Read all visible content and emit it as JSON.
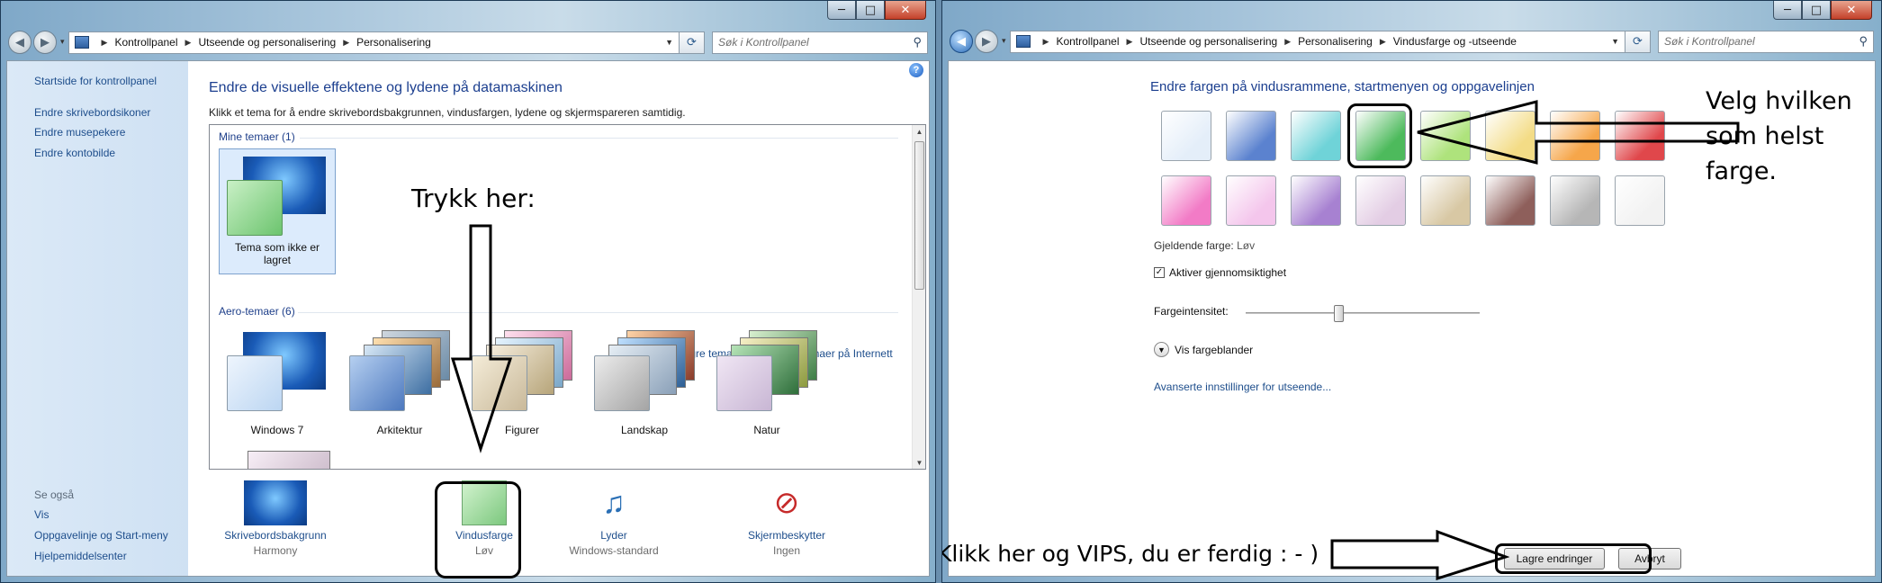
{
  "window1": {
    "title_buttons": {
      "minimize": "─",
      "maximize": "□",
      "close": "✕"
    },
    "address": {
      "crumbs": [
        "Kontrollpanel",
        "Utseende og personalisering",
        "Personalisering"
      ]
    },
    "search_placeholder": "Søk i Kontrollpanel",
    "sidebar": {
      "home": "Startside for kontrollpanel",
      "links": [
        "Endre skrivebordsikoner",
        "Endre musepekere",
        "Endre kontobilde"
      ],
      "see_also": "Se også",
      "see_also_links": [
        "Vis",
        "Oppgavelinje og Start-meny",
        "Hjelpemiddelsenter"
      ]
    },
    "heading": "Endre de visuelle effektene og lydene på datamaskinen",
    "subheading": "Klikk et tema for å endre skrivebordsbakgrunnen, vindusfargen, lydene og skjermspareren samtidig.",
    "my_themes_label": "Mine temaer (1)",
    "my_theme": "Tema som ikke er lagret",
    "save_theme_link": "Lagre tema",
    "more_themes_link": "Hent flere temaer på Internett",
    "aero_label": "Aero-temaer (6)",
    "aero_themes": [
      "Windows 7",
      "Arkitektur",
      "Figurer",
      "Landskap",
      "Natur"
    ],
    "bottom": [
      {
        "label": "Skrivebordsbakgrunn",
        "value": "Harmony"
      },
      {
        "label": "Vindusfarge",
        "value": "Løv"
      },
      {
        "label": "Lyder",
        "value": "Windows-standard"
      },
      {
        "label": "Skjermbeskytter",
        "value": "Ingen"
      }
    ],
    "annotation": "Trykk her:"
  },
  "window2": {
    "address": {
      "crumbs": [
        "Kontrollpanel",
        "Utseende og personalisering",
        "Personalisering",
        "Vindusfarge og -utseende"
      ]
    },
    "search_placeholder": "Søk i Kontrollpanel",
    "heading": "Endre fargen på vindusrammene, startmenyen og oppgavelinjen",
    "colors_row1": [
      "#e4eef9",
      "#5b82cf",
      "#6fd3d8",
      "#4dba5c",
      "#aee37c",
      "#f3dc86",
      "#f6a64a",
      "#e0474b"
    ],
    "colors_row2": [
      "#f27bc6",
      "#f4c6ec",
      "#a781d1",
      "#e3cde4",
      "#d8c8a4",
      "#8e5f5b",
      "#b6b6b6",
      "#f2f2f2"
    ],
    "current_color_label": "Gjeldende farge:",
    "current_color_value": "Løv",
    "transparency_label": "Aktiver gjennomsiktighet",
    "transparency_checked": true,
    "intensity_label": "Fargeintensitet:",
    "intensity_value": 0.4,
    "mixer_label": "Vis fargeblander",
    "advanced_link": "Avanserte innstillinger for utseende...",
    "save_button": "Lagre endringer",
    "cancel_button": "Avbryt",
    "annotation_pick": "Velg hvilken som helst farge.",
    "annotation_done": "Klikk her og VIPS, du er ferdig : - )"
  }
}
